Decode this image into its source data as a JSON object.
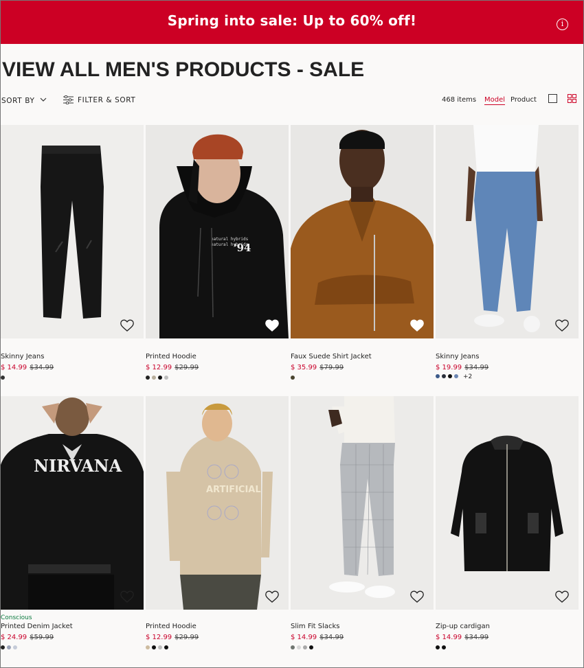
{
  "banner": {
    "message": "Spring into sale: Up to 60% off!",
    "info_glyph": "i",
    "color": "#cc0024"
  },
  "page_title": "VIEW ALL MEN'S PRODUCTS - SALE",
  "toolbar": {
    "sort_label": "SORT BY",
    "filter_label": "FILTER & SORT",
    "item_count": "468 items",
    "view_model": "Model",
    "view_product": "Product"
  },
  "products": [
    {
      "name": "Skinny Jeans",
      "tag": "",
      "price": "$ 14.99",
      "old_price": "$34.99",
      "swatches": [
        "#333333"
      ],
      "more": ""
    },
    {
      "name": "Printed Hoodie",
      "tag": "",
      "price": "$ 12.99",
      "old_price": "$29.99",
      "swatches": [
        "#222222",
        "#b8ae9c",
        "#111111",
        "#bdbdbd"
      ],
      "more": ""
    },
    {
      "name": "Faux Suede Shirt Jacket",
      "tag": "",
      "price": "$ 35.99",
      "old_price": "$79.99",
      "swatches": [
        "#4a4530"
      ],
      "more": ""
    },
    {
      "name": "Skinny Jeans",
      "tag": "",
      "price": "$ 19.99",
      "old_price": "$34.99",
      "swatches": [
        "#3c5a8a",
        "#2a2f3a",
        "#111111",
        "#6c87b3"
      ],
      "more": "+2"
    },
    {
      "name": "Printed Denim Jacket",
      "tag": "Conscious",
      "price": "$ 24.99",
      "old_price": "$59.99",
      "swatches": [
        "#222222",
        "#9aa3b8",
        "#c5cbd8"
      ],
      "more": ""
    },
    {
      "name": "Printed Hoodie",
      "tag": "",
      "price": "$ 12.99",
      "old_price": "$29.99",
      "swatches": [
        "#cdbb9f",
        "#111111",
        "#bdbdbd",
        "#111111"
      ],
      "more": ""
    },
    {
      "name": "Slim Fit Slacks",
      "tag": "",
      "price": "$ 14.99",
      "old_price": "$34.99",
      "swatches": [
        "#6f7570",
        "#d8d8d8",
        "#a8a8a8",
        "#111111"
      ],
      "more": ""
    },
    {
      "name": "Zip-up cardigan",
      "tag": "",
      "price": "$ 14.99",
      "old_price": "$34.99",
      "swatches": [
        "#111111",
        "#111111"
      ],
      "more": ""
    }
  ]
}
